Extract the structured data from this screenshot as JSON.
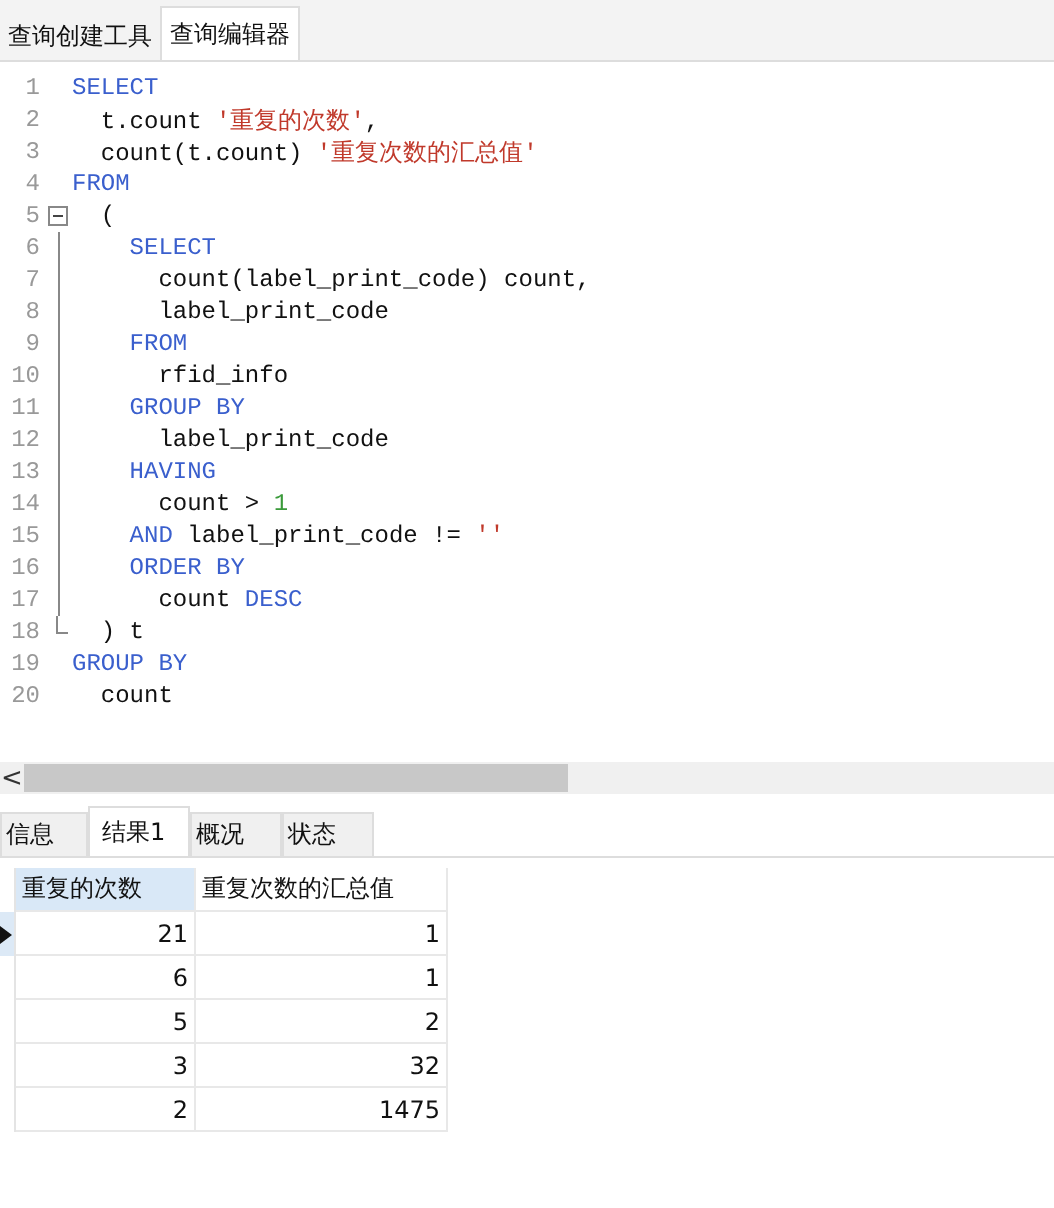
{
  "editor_tabs": [
    {
      "label": "查询创建工具",
      "selected": false
    },
    {
      "label": "查询编辑器",
      "selected": true
    }
  ],
  "code_lines": [
    {
      "number": "1",
      "tokens": [
        {
          "kind": "keyword",
          "text": "SELECT"
        }
      ]
    },
    {
      "number": "2",
      "tokens": [
        {
          "kind": "plain",
          "text": "  t.count "
        },
        {
          "kind": "string",
          "text": "'重复的次数'"
        },
        {
          "kind": "plain",
          "text": ","
        }
      ]
    },
    {
      "number": "3",
      "tokens": [
        {
          "kind": "plain",
          "text": "  count(t.count) "
        },
        {
          "kind": "string",
          "text": "'重复次数的汇总值'"
        }
      ]
    },
    {
      "number": "4",
      "tokens": [
        {
          "kind": "keyword",
          "text": "FROM"
        }
      ]
    },
    {
      "number": "5",
      "gutter": {
        "kind": "collapse"
      },
      "tokens": [
        {
          "kind": "plain",
          "text": "  ("
        }
      ]
    },
    {
      "number": "6",
      "gutter": {
        "kind": "fold-line"
      },
      "tokens": [
        {
          "kind": "keyword",
          "text": "    SELECT"
        }
      ]
    },
    {
      "number": "7",
      "gutter": {
        "kind": "fold-line"
      },
      "tokens": [
        {
          "kind": "plain",
          "text": "      count(label_print_code) count,"
        }
      ]
    },
    {
      "number": "8",
      "gutter": {
        "kind": "fold-line"
      },
      "tokens": [
        {
          "kind": "plain",
          "text": "      label_print_code"
        }
      ]
    },
    {
      "number": "9",
      "gutter": {
        "kind": "fold-line"
      },
      "tokens": [
        {
          "kind": "keyword",
          "text": "    FROM"
        }
      ]
    },
    {
      "number": "10",
      "gutter": {
        "kind": "fold-line"
      },
      "tokens": [
        {
          "kind": "plain",
          "text": "      rfid_info"
        }
      ]
    },
    {
      "number": "11",
      "gutter": {
        "kind": "fold-line"
      },
      "tokens": [
        {
          "kind": "keyword",
          "text": "    GROUP BY"
        }
      ]
    },
    {
      "number": "12",
      "gutter": {
        "kind": "fold-line"
      },
      "tokens": [
        {
          "kind": "plain",
          "text": "      label_print_code"
        }
      ]
    },
    {
      "number": "13",
      "gutter": {
        "kind": "fold-line"
      },
      "tokens": [
        {
          "kind": "keyword",
          "text": "    HAVING"
        }
      ]
    },
    {
      "number": "14",
      "gutter": {
        "kind": "fold-line"
      },
      "tokens": [
        {
          "kind": "plain",
          "text": "      count > "
        },
        {
          "kind": "number",
          "text": "1"
        }
      ]
    },
    {
      "number": "15",
      "gutter": {
        "kind": "fold-line"
      },
      "tokens": [
        {
          "kind": "keyword",
          "text": "    AND"
        },
        {
          "kind": "plain",
          "text": " label_print_code != "
        },
        {
          "kind": "string",
          "text": "''"
        }
      ]
    },
    {
      "number": "16",
      "gutter": {
        "kind": "fold-line"
      },
      "tokens": [
        {
          "kind": "keyword",
          "text": "    ORDER BY"
        }
      ]
    },
    {
      "number": "17",
      "gutter": {
        "kind": "fold-line"
      },
      "tokens": [
        {
          "kind": "plain",
          "text": "      count "
        },
        {
          "kind": "keyword",
          "text": "DESC"
        }
      ]
    },
    {
      "number": "18",
      "gutter": {
        "kind": "fold-end"
      },
      "tokens": [
        {
          "kind": "plain",
          "text": "  ) t"
        }
      ]
    },
    {
      "number": "19",
      "tokens": [
        {
          "kind": "keyword",
          "text": "GROUP BY"
        }
      ]
    },
    {
      "number": "20",
      "tokens": [
        {
          "kind": "plain",
          "text": "  count"
        }
      ]
    }
  ],
  "scroll_left": "<",
  "result_tabs": [
    {
      "label": "信息",
      "selected": false
    },
    {
      "label": "结果1",
      "selected": true
    },
    {
      "label": "概况",
      "selected": false
    },
    {
      "label": "状态",
      "selected": false
    }
  ],
  "table": {
    "columns": [
      {
        "label": "重复的次数",
        "selected": true
      },
      {
        "label": "重复次数的汇总值",
        "selected": false
      }
    ],
    "rows": [
      {
        "current": true,
        "cells": [
          "21",
          "1"
        ]
      },
      {
        "current": false,
        "cells": [
          "6",
          "1"
        ]
      },
      {
        "current": false,
        "cells": [
          "5",
          "2"
        ]
      },
      {
        "current": false,
        "cells": [
          "3",
          "32"
        ]
      },
      {
        "current": false,
        "cells": [
          "2",
          "1475"
        ]
      }
    ]
  }
}
